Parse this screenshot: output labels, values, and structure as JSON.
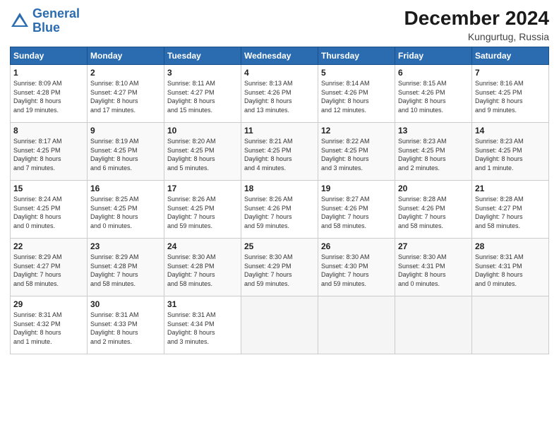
{
  "header": {
    "logo_line1": "General",
    "logo_line2": "Blue",
    "month_title": "December 2024",
    "location": "Kungurtug, Russia"
  },
  "days_of_week": [
    "Sunday",
    "Monday",
    "Tuesday",
    "Wednesday",
    "Thursday",
    "Friday",
    "Saturday"
  ],
  "weeks": [
    [
      {
        "day": 1,
        "info": "Sunrise: 8:09 AM\nSunset: 4:28 PM\nDaylight: 8 hours\nand 19 minutes."
      },
      {
        "day": 2,
        "info": "Sunrise: 8:10 AM\nSunset: 4:27 PM\nDaylight: 8 hours\nand 17 minutes."
      },
      {
        "day": 3,
        "info": "Sunrise: 8:11 AM\nSunset: 4:27 PM\nDaylight: 8 hours\nand 15 minutes."
      },
      {
        "day": 4,
        "info": "Sunrise: 8:13 AM\nSunset: 4:26 PM\nDaylight: 8 hours\nand 13 minutes."
      },
      {
        "day": 5,
        "info": "Sunrise: 8:14 AM\nSunset: 4:26 PM\nDaylight: 8 hours\nand 12 minutes."
      },
      {
        "day": 6,
        "info": "Sunrise: 8:15 AM\nSunset: 4:26 PM\nDaylight: 8 hours\nand 10 minutes."
      },
      {
        "day": 7,
        "info": "Sunrise: 8:16 AM\nSunset: 4:25 PM\nDaylight: 8 hours\nand 9 minutes."
      }
    ],
    [
      {
        "day": 8,
        "info": "Sunrise: 8:17 AM\nSunset: 4:25 PM\nDaylight: 8 hours\nand 7 minutes."
      },
      {
        "day": 9,
        "info": "Sunrise: 8:19 AM\nSunset: 4:25 PM\nDaylight: 8 hours\nand 6 minutes."
      },
      {
        "day": 10,
        "info": "Sunrise: 8:20 AM\nSunset: 4:25 PM\nDaylight: 8 hours\nand 5 minutes."
      },
      {
        "day": 11,
        "info": "Sunrise: 8:21 AM\nSunset: 4:25 PM\nDaylight: 8 hours\nand 4 minutes."
      },
      {
        "day": 12,
        "info": "Sunrise: 8:22 AM\nSunset: 4:25 PM\nDaylight: 8 hours\nand 3 minutes."
      },
      {
        "day": 13,
        "info": "Sunrise: 8:23 AM\nSunset: 4:25 PM\nDaylight: 8 hours\nand 2 minutes."
      },
      {
        "day": 14,
        "info": "Sunrise: 8:23 AM\nSunset: 4:25 PM\nDaylight: 8 hours\nand 1 minute."
      }
    ],
    [
      {
        "day": 15,
        "info": "Sunrise: 8:24 AM\nSunset: 4:25 PM\nDaylight: 8 hours\nand 0 minutes."
      },
      {
        "day": 16,
        "info": "Sunrise: 8:25 AM\nSunset: 4:25 PM\nDaylight: 8 hours\nand 0 minutes."
      },
      {
        "day": 17,
        "info": "Sunrise: 8:26 AM\nSunset: 4:25 PM\nDaylight: 7 hours\nand 59 minutes."
      },
      {
        "day": 18,
        "info": "Sunrise: 8:26 AM\nSunset: 4:26 PM\nDaylight: 7 hours\nand 59 minutes."
      },
      {
        "day": 19,
        "info": "Sunrise: 8:27 AM\nSunset: 4:26 PM\nDaylight: 7 hours\nand 58 minutes."
      },
      {
        "day": 20,
        "info": "Sunrise: 8:28 AM\nSunset: 4:26 PM\nDaylight: 7 hours\nand 58 minutes."
      },
      {
        "day": 21,
        "info": "Sunrise: 8:28 AM\nSunset: 4:27 PM\nDaylight: 7 hours\nand 58 minutes."
      }
    ],
    [
      {
        "day": 22,
        "info": "Sunrise: 8:29 AM\nSunset: 4:27 PM\nDaylight: 7 hours\nand 58 minutes."
      },
      {
        "day": 23,
        "info": "Sunrise: 8:29 AM\nSunset: 4:28 PM\nDaylight: 7 hours\nand 58 minutes."
      },
      {
        "day": 24,
        "info": "Sunrise: 8:30 AM\nSunset: 4:28 PM\nDaylight: 7 hours\nand 58 minutes."
      },
      {
        "day": 25,
        "info": "Sunrise: 8:30 AM\nSunset: 4:29 PM\nDaylight: 7 hours\nand 59 minutes."
      },
      {
        "day": 26,
        "info": "Sunrise: 8:30 AM\nSunset: 4:30 PM\nDaylight: 7 hours\nand 59 minutes."
      },
      {
        "day": 27,
        "info": "Sunrise: 8:30 AM\nSunset: 4:31 PM\nDaylight: 8 hours\nand 0 minutes."
      },
      {
        "day": 28,
        "info": "Sunrise: 8:31 AM\nSunset: 4:31 PM\nDaylight: 8 hours\nand 0 minutes."
      }
    ],
    [
      {
        "day": 29,
        "info": "Sunrise: 8:31 AM\nSunset: 4:32 PM\nDaylight: 8 hours\nand 1 minute."
      },
      {
        "day": 30,
        "info": "Sunrise: 8:31 AM\nSunset: 4:33 PM\nDaylight: 8 hours\nand 2 minutes."
      },
      {
        "day": 31,
        "info": "Sunrise: 8:31 AM\nSunset: 4:34 PM\nDaylight: 8 hours\nand 3 minutes."
      },
      null,
      null,
      null,
      null
    ]
  ]
}
